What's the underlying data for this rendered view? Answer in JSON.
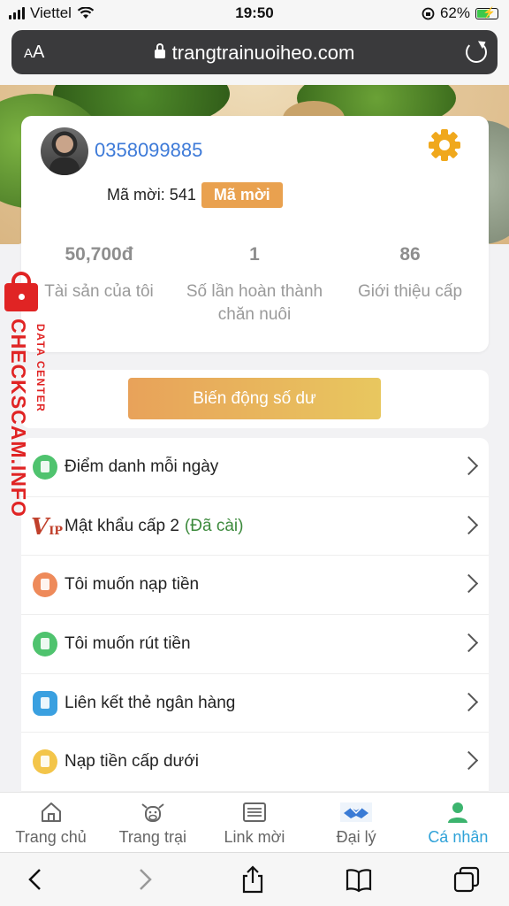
{
  "status_bar": {
    "carrier": "Viettel",
    "time": "19:50",
    "battery": "62%"
  },
  "browser": {
    "text_size": "AA",
    "url": "trangtrainuoiheo.com"
  },
  "profile": {
    "phone": "0358099885",
    "invite_label": "Mã mời: 541",
    "invite_button": "Mã mời"
  },
  "stats": [
    {
      "value": "50,700đ",
      "label": "Tài sản của tôi"
    },
    {
      "value": "1",
      "label": "Số lần hoàn thành chăn nuôi"
    },
    {
      "value": "86",
      "label": "Giới thiệu cấp"
    }
  ],
  "balance_button": "Biến động số dư",
  "menu": [
    {
      "label": "Điểm danh mỗi ngày",
      "icon": "calendar-icon",
      "color": "#4fc36e"
    },
    {
      "label": "Mật khẩu cấp 2",
      "extra": "(Đã cài)",
      "icon": "vip-icon",
      "color": "#c0402b"
    },
    {
      "label": "Tôi muốn nạp tiền",
      "icon": "wallet-icon",
      "color": "#ee8a5a"
    },
    {
      "label": "Tôi muốn rút tiền",
      "icon": "withdraw-icon",
      "color": "#4fc36e"
    },
    {
      "label": "Liên kết thẻ ngân hàng",
      "icon": "card-icon",
      "color": "#3aa0e0"
    },
    {
      "label": "Nạp tiền cấp dưới",
      "icon": "list-icon",
      "color": "#f3c54a"
    }
  ],
  "tabs": [
    {
      "label": "Trang chủ",
      "icon": "home-icon"
    },
    {
      "label": "Trang trại",
      "icon": "cow-icon"
    },
    {
      "label": "Link mời",
      "icon": "link-icon"
    },
    {
      "label": "Đại lý",
      "icon": "handshake-icon"
    },
    {
      "label": "Cá nhân",
      "icon": "person-icon",
      "active": true
    }
  ],
  "watermark": {
    "main": "CHECKSCAM.INFO",
    "sub": "DATA CENTER"
  },
  "colors": {
    "accent": "#2fa2d8",
    "link": "#3d7ad8",
    "gold": "#e9a14f"
  }
}
